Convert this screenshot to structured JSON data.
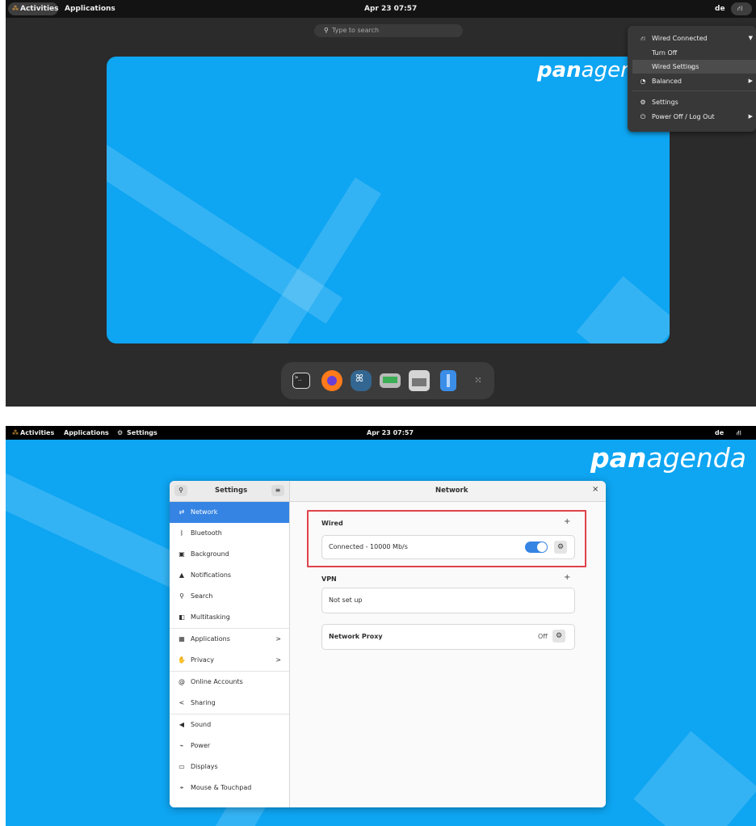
{
  "overview": {
    "activities": "Activities",
    "applications": "Applications",
    "clock": "Apr 23  07:57",
    "lang": "de",
    "search_placeholder": "Type to search",
    "brand_visible": "panagen",
    "dock": [
      "terminal",
      "firefox",
      "pgadmin",
      "disks",
      "printer",
      "files",
      "show-apps"
    ],
    "system_menu": {
      "wired_connected": "Wired Connected",
      "turn_off": "Turn Off",
      "wired_settings": "Wired Settings",
      "balanced": "Balanced",
      "settings": "Settings",
      "power": "Power Off / Log Out"
    }
  },
  "desktop": {
    "activities": "Activities",
    "applications": "Applications",
    "app_name": "Settings",
    "clock": "Apr 23  07:57",
    "lang": "de",
    "brand": "panagenda"
  },
  "settings_window": {
    "sidebar_title": "Settings",
    "panel_title": "Network",
    "close": "×",
    "sidebar_items": [
      {
        "label": "Network",
        "icon": "network-icon",
        "selected": true
      },
      {
        "label": "Bluetooth",
        "icon": "bluetooth-icon"
      },
      {
        "label": "Background",
        "icon": "background-icon"
      },
      {
        "label": "Notifications",
        "icon": "bell-icon"
      },
      {
        "label": "Search",
        "icon": "search-icon"
      },
      {
        "label": "Multitasking",
        "icon": "multitasking-icon"
      },
      {
        "label": "Applications",
        "icon": "apps-icon",
        "chevron": true
      },
      {
        "label": "Privacy",
        "icon": "hand-icon",
        "chevron": true
      },
      {
        "label": "Online Accounts",
        "icon": "at-icon"
      },
      {
        "label": "Sharing",
        "icon": "share-icon"
      },
      {
        "label": "Sound",
        "icon": "speaker-icon"
      },
      {
        "label": "Power",
        "icon": "power-icon"
      },
      {
        "label": "Displays",
        "icon": "display-icon"
      },
      {
        "label": "Mouse & Touchpad",
        "icon": "mouse-icon"
      }
    ],
    "wired": {
      "title": "Wired",
      "status": "Connected - 10000 Mb/s",
      "enabled": true
    },
    "vpn": {
      "title": "VPN",
      "status": "Not set up"
    },
    "proxy": {
      "title": "Network Proxy",
      "status": "Off"
    }
  },
  "colors": {
    "accent": "#3584e4",
    "desktop_blue": "#0ea5f2",
    "highlight_box": "#e0434b"
  }
}
